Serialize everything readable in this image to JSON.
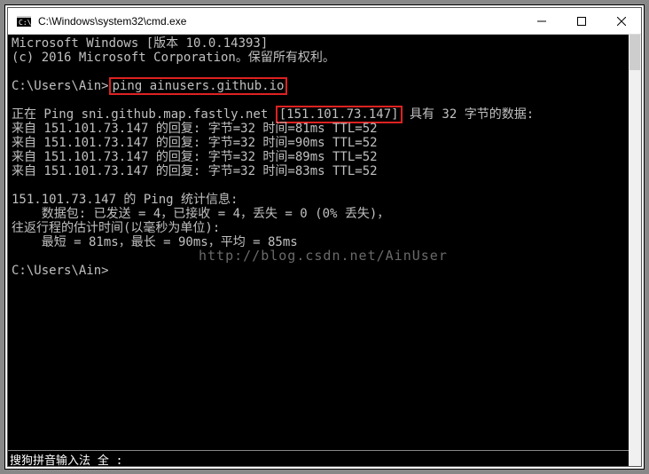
{
  "title": "C:\\Windows\\system32\\cmd.exe",
  "term": {
    "header1": "Microsoft Windows [版本 10.0.14393]",
    "header2": "(c) 2016 Microsoft Corporation。保留所有权利。",
    "prompt1_prefix": "C:\\Users\\Ain>",
    "prompt1_cmd": "ping ainusers.github.io",
    "ping_line_a": "正在 Ping sni.github.map.fastly.net ",
    "ping_ip": "[151.101.73.147]",
    "ping_line_b": " 具有 32 字节的数据:",
    "reply1": "来自 151.101.73.147 的回复: 字节=32 时间=81ms TTL=52",
    "reply2": "来自 151.101.73.147 的回复: 字节=32 时间=90ms TTL=52",
    "reply3": "来自 151.101.73.147 的回复: 字节=32 时间=89ms TTL=52",
    "reply4": "来自 151.101.73.147 的回复: 字节=32 时间=83ms TTL=52",
    "stats_head": "151.101.73.147 的 Ping 统计信息:",
    "stats_pkts": "    数据包: 已发送 = 4，已接收 = 4，丢失 = 0 (0% 丢失)，",
    "stats_rtt_head": "往返行程的估计时间(以毫秒为单位):",
    "stats_rtt": "    最短 = 81ms，最长 = 90ms，平均 = 85ms",
    "prompt2": "C:\\Users\\Ain>"
  },
  "watermark": "http://blog.csdn.net/AinUser",
  "ime": "搜狗拼音输入法  全 :"
}
